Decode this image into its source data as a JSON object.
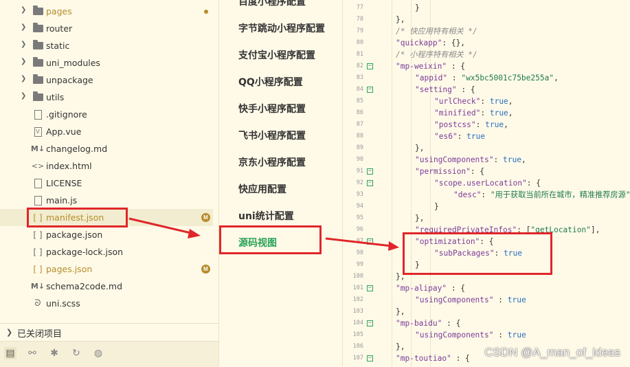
{
  "explorer": {
    "items": [
      {
        "name": "pages",
        "kind": "folder",
        "chevron": true,
        "color": "#b58d2a",
        "mark": "dot"
      },
      {
        "name": "router",
        "kind": "folder",
        "chevron": true
      },
      {
        "name": "static",
        "kind": "folder",
        "chevron": true
      },
      {
        "name": "uni_modules",
        "kind": "folder",
        "chevron": true
      },
      {
        "name": "unpackage",
        "kind": "folder",
        "chevron": true
      },
      {
        "name": "utils",
        "kind": "folder",
        "chevron": true
      },
      {
        "name": ".gitignore",
        "kind": "file"
      },
      {
        "name": "App.vue",
        "kind": "vue"
      },
      {
        "name": "changelog.md",
        "kind": "md"
      },
      {
        "name": "index.html",
        "kind": "html"
      },
      {
        "name": "LICENSE",
        "kind": "file"
      },
      {
        "name": "main.js",
        "kind": "file"
      },
      {
        "name": "manifest.json",
        "kind": "json",
        "color": "#b58d2a",
        "mark": "M",
        "selected": true
      },
      {
        "name": "package.json",
        "kind": "json"
      },
      {
        "name": "package-lock.json",
        "kind": "json"
      },
      {
        "name": "pages.json",
        "kind": "json",
        "color": "#b58d2a",
        "mark": "M"
      },
      {
        "name": "schema2code.md",
        "kind": "md"
      },
      {
        "name": "uni.scss",
        "kind": "scss"
      }
    ],
    "closed_projects_label": "已关闭项目",
    "toolbar_icons": [
      "explorer-icon",
      "binoculars-icon",
      "bug-icon",
      "git-icon",
      "palette-icon"
    ]
  },
  "settings_nav": {
    "items": [
      {
        "label": "百度小程序配置"
      },
      {
        "label": "字节跳动小程序配置"
      },
      {
        "label": "支付宝小程序配置"
      },
      {
        "label": "QQ小程序配置"
      },
      {
        "label": "快手小程序配置"
      },
      {
        "label": "飞书小程序配置"
      },
      {
        "label": "京东小程序配置"
      },
      {
        "label": "快应用配置"
      },
      {
        "label": "uni统计配置"
      },
      {
        "label": "源码视图",
        "active": true
      }
    ]
  },
  "editor": {
    "lines": [
      {
        "n": "77",
        "indent": 2,
        "fold": false,
        "tokens": [
          [
            "p",
            "}"
          ]
        ]
      },
      {
        "n": "78",
        "indent": 1,
        "fold": false,
        "tokens": [
          [
            "p",
            "},"
          ]
        ]
      },
      {
        "n": "79",
        "indent": 1,
        "fold": false,
        "tokens": [
          [
            "c",
            "/* 快应用特有相关 */"
          ]
        ]
      },
      {
        "n": "80",
        "indent": 1,
        "fold": false,
        "tokens": [
          [
            "k",
            "\"quickapp\""
          ],
          [
            "p",
            ": {},"
          ]
        ]
      },
      {
        "n": "81",
        "indent": 1,
        "fold": false,
        "tokens": [
          [
            "c",
            "/* 小程序特有相关 */"
          ]
        ]
      },
      {
        "n": "82",
        "indent": 1,
        "fold": true,
        "tokens": [
          [
            "k",
            "\"mp-weixin\""
          ],
          [
            "p",
            " : {"
          ]
        ]
      },
      {
        "n": "83",
        "indent": 2,
        "fold": false,
        "tokens": [
          [
            "k",
            "\"appid\""
          ],
          [
            "p",
            " : "
          ],
          [
            "s",
            "\"wx5bc5001c75be255a\""
          ],
          [
            "p",
            ","
          ]
        ]
      },
      {
        "n": "84",
        "indent": 2,
        "fold": true,
        "tokens": [
          [
            "k",
            "\"setting\""
          ],
          [
            "p",
            " : {"
          ]
        ]
      },
      {
        "n": "85",
        "indent": 3,
        "fold": false,
        "tokens": [
          [
            "k",
            "\"urlCheck\""
          ],
          [
            "p",
            ": "
          ],
          [
            "b",
            "true"
          ],
          [
            "p",
            ","
          ]
        ]
      },
      {
        "n": "86",
        "indent": 3,
        "fold": false,
        "tokens": [
          [
            "k",
            "\"minified\""
          ],
          [
            "p",
            ": "
          ],
          [
            "b",
            "true"
          ],
          [
            "p",
            ","
          ]
        ]
      },
      {
        "n": "87",
        "indent": 3,
        "fold": false,
        "tokens": [
          [
            "k",
            "\"postcss\""
          ],
          [
            "p",
            ": "
          ],
          [
            "b",
            "true"
          ],
          [
            "p",
            ","
          ]
        ]
      },
      {
        "n": "88",
        "indent": 3,
        "fold": false,
        "tokens": [
          [
            "k",
            "\"es6\""
          ],
          [
            "p",
            ": "
          ],
          [
            "b",
            "true"
          ]
        ]
      },
      {
        "n": "89",
        "indent": 2,
        "fold": false,
        "tokens": [
          [
            "p",
            "},"
          ]
        ]
      },
      {
        "n": "90",
        "indent": 2,
        "fold": false,
        "tokens": [
          [
            "k",
            "\"usingComponents\""
          ],
          [
            "p",
            ": "
          ],
          [
            "b",
            "true"
          ],
          [
            "p",
            ","
          ]
        ]
      },
      {
        "n": "91",
        "indent": 2,
        "fold": true,
        "tokens": [
          [
            "k",
            "\"permission\""
          ],
          [
            "p",
            ": {"
          ]
        ]
      },
      {
        "n": "92",
        "indent": 3,
        "fold": true,
        "tokens": [
          [
            "k",
            "\"scope.userLocation\""
          ],
          [
            "p",
            ": {"
          ]
        ]
      },
      {
        "n": "93",
        "indent": 4,
        "fold": false,
        "tokens": [
          [
            "k",
            "\"desc\""
          ],
          [
            "p",
            ": "
          ],
          [
            "s",
            "\"用于获取当前所在城市，精准推荐房源\""
          ]
        ]
      },
      {
        "n": "94",
        "indent": 3,
        "fold": false,
        "tokens": [
          [
            "p",
            "}"
          ]
        ]
      },
      {
        "n": "95",
        "indent": 2,
        "fold": false,
        "tokens": [
          [
            "p",
            "},"
          ]
        ]
      },
      {
        "n": "96",
        "indent": 2,
        "fold": false,
        "tokens": [
          [
            "k",
            "\"requiredPrivateInfos\""
          ],
          [
            "p",
            ": ["
          ],
          [
            "s",
            "\"getLocation\""
          ],
          [
            "p",
            "],"
          ]
        ]
      },
      {
        "n": "97",
        "indent": 2,
        "fold": true,
        "tokens": [
          [
            "k",
            "\"optimization\""
          ],
          [
            "p",
            ": {"
          ]
        ]
      },
      {
        "n": "98",
        "indent": 3,
        "fold": false,
        "tokens": [
          [
            "k",
            "\"subPackages\""
          ],
          [
            "p",
            ": "
          ],
          [
            "b",
            "true"
          ]
        ]
      },
      {
        "n": "99",
        "indent": 2,
        "fold": false,
        "tokens": [
          [
            "p",
            "}"
          ]
        ]
      },
      {
        "n": "100",
        "indent": 1,
        "fold": false,
        "tokens": [
          [
            "p",
            "},"
          ]
        ]
      },
      {
        "n": "101",
        "indent": 1,
        "fold": true,
        "tokens": [
          [
            "k",
            "\"mp-alipay\""
          ],
          [
            "p",
            " : {"
          ]
        ]
      },
      {
        "n": "102",
        "indent": 2,
        "fold": false,
        "tokens": [
          [
            "k",
            "\"usingComponents\""
          ],
          [
            "p",
            " : "
          ],
          [
            "b",
            "true"
          ]
        ]
      },
      {
        "n": "103",
        "indent": 1,
        "fold": false,
        "tokens": [
          [
            "p",
            "},"
          ]
        ]
      },
      {
        "n": "104",
        "indent": 1,
        "fold": true,
        "tokens": [
          [
            "k",
            "\"mp-baidu\""
          ],
          [
            "p",
            " : {"
          ]
        ]
      },
      {
        "n": "105",
        "indent": 2,
        "fold": false,
        "tokens": [
          [
            "k",
            "\"usingComponents\""
          ],
          [
            "p",
            " : "
          ],
          [
            "b",
            "true"
          ]
        ]
      },
      {
        "n": "106",
        "indent": 1,
        "fold": false,
        "tokens": [
          [
            "p",
            "},"
          ]
        ]
      },
      {
        "n": "107",
        "indent": 1,
        "fold": true,
        "tokens": [
          [
            "k",
            "\"mp-toutiao\""
          ],
          [
            "p",
            " : {"
          ]
        ]
      }
    ]
  },
  "watermark": "CSDN @A_man_of_ideas",
  "colors": {
    "accent_green": "#2aa25a",
    "highlight_red": "#e0262a",
    "modified": "#b58d2a"
  }
}
